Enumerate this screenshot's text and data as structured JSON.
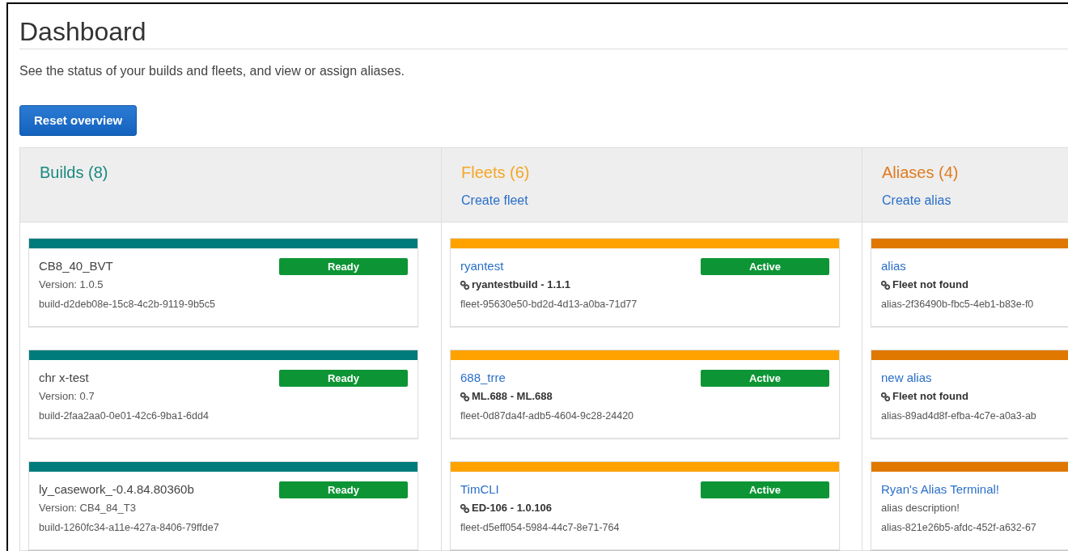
{
  "title": "Dashboard",
  "subtitle": "See the status of your builds and fleets, and view or assign aliases.",
  "reset_button": "Reset overview",
  "columns": [
    {
      "kind": "build",
      "title": "Builds (8)",
      "color": "#007b7b",
      "cards": [
        {
          "name": "CB8_40_BVT",
          "status": "Ready",
          "detail": {
            "kind": "version",
            "text": "Version: 1.0.5"
          },
          "id": "build-d2deb08e-15c8-4c2b-9119-9b5c5"
        },
        {
          "name": "chr x-test",
          "status": "Ready",
          "detail": {
            "kind": "version",
            "text": "Version: 0.7"
          },
          "id": "build-2faa2aa0-0e01-42c6-9ba1-6dd4"
        },
        {
          "name": "ly_casework_-0.4.84.80360b",
          "status": "Ready",
          "detail": {
            "kind": "version",
            "text": "Version: CB4_84_T3"
          },
          "id": "build-1260fc34-a11e-427a-8406-79ffde7"
        }
      ]
    },
    {
      "kind": "fleet",
      "title": "Fleets (6)",
      "action": "Create fleet",
      "color": "#ffa200",
      "cards": [
        {
          "name": "ryantest",
          "status": "Active",
          "detail": {
            "kind": "link",
            "text": "ryantestbuild - 1.1.1"
          },
          "id": "fleet-95630e50-bd2d-4d13-a0ba-71d77"
        },
        {
          "name": "688_trre",
          "status": "Active",
          "detail": {
            "kind": "link",
            "text": "ML.688 - ML.688"
          },
          "id": "fleet-0d87da4f-adb5-4604-9c28-24420"
        },
        {
          "name": "TimCLI",
          "status": "Active",
          "detail": {
            "kind": "link",
            "text": "ED-106 - 1.0.106"
          },
          "id": "fleet-d5eff054-5984-44c7-8e71-764"
        }
      ]
    },
    {
      "kind": "alias",
      "title": "Aliases (4)",
      "action": "Create alias",
      "color": "#e07800",
      "cards": [
        {
          "name": "alias",
          "detail": {
            "kind": "link",
            "text": "Fleet not found"
          },
          "id": "alias-2f36490b-fbc5-4eb1-b83e-f0"
        },
        {
          "name": "new alias",
          "detail": {
            "kind": "link",
            "text": "Fleet not found"
          },
          "id": "alias-89ad4d8f-efba-4c7e-a0a3-ab"
        },
        {
          "name": "Ryan's Alias Terminal!",
          "detail": {
            "kind": "description",
            "text": "alias description!"
          },
          "id": "alias-821e26b5-afdc-452f-a632-67"
        }
      ]
    }
  ]
}
